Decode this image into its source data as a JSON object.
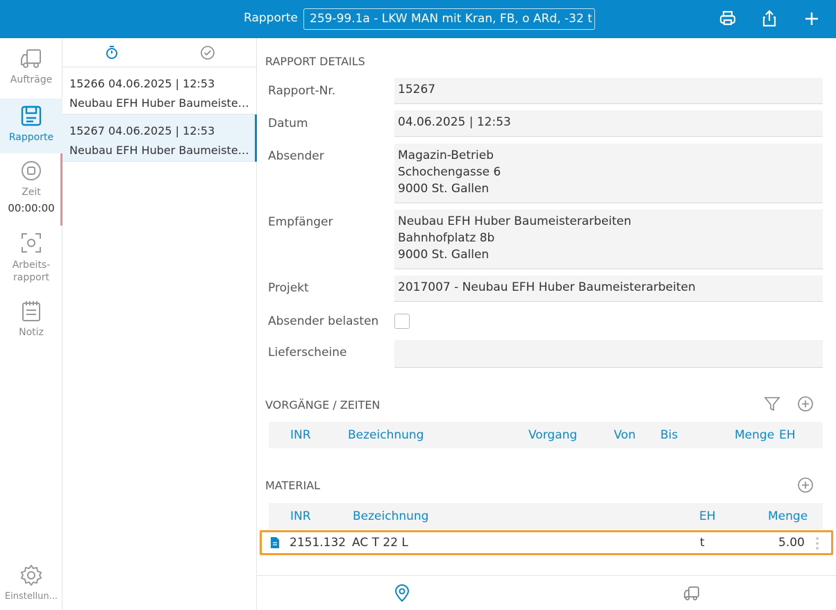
{
  "header": {
    "title": "Rapporte",
    "vehicle": "259-99.1a - LKW MAN mit Kran, FB, o ARd, -32 t",
    "icons": [
      "printer-icon",
      "share-icon",
      "plus-icon"
    ]
  },
  "nav": {
    "items": [
      {
        "label": "Aufträge",
        "icon": "truck-icon"
      },
      {
        "label": "Rapporte",
        "icon": "report-icon"
      },
      {
        "label": "Zeit",
        "icon": "stop-icon",
        "value": "00:00:00"
      },
      {
        "label": "Arbeits-\nrapport",
        "icon": "scan-icon"
      },
      {
        "label": "Notiz",
        "icon": "notepad-icon"
      },
      {
        "label": "Einstellun...",
        "icon": "gear-icon"
      }
    ]
  },
  "list": {
    "rows": [
      {
        "line1": "15266  04.06.2025 | 12:53",
        "line2": "Neubau EFH Huber Baumeisterarbeiten"
      },
      {
        "line1": "15267  04.06.2025 | 12:53",
        "line2": "Neubau EFH Huber Baumeisterarbeiten"
      }
    ]
  },
  "details": {
    "section": "RAPPORT DETAILS",
    "rapport_nr_label": "Rapport-Nr.",
    "rapport_nr": "15267",
    "datum_label": "Datum",
    "datum": "04.06.2025 | 12:53",
    "absender_label": "Absender",
    "absender": [
      "Magazin-Betrieb",
      "Schochengasse 6",
      "9000 St. Gallen"
    ],
    "empfaenger_label": "Empfänger",
    "empfaenger": [
      "Neubau EFH Huber Baumeisterarbeiten",
      "Bahnhofplatz 8b",
      "9000 St. Gallen"
    ],
    "projekt_label": "Projekt",
    "projekt": "2017007 - Neubau EFH Huber Baumeisterarbeiten",
    "absender_belasten_label": "Absender belasten",
    "absender_belasten": false,
    "lieferscheine_label": "Lieferscheine",
    "lieferscheine": ""
  },
  "vorgaenge": {
    "section": "VORGÄNGE / ZEITEN",
    "columns": [
      "INR",
      "Bezeichnung",
      "Vorgang",
      "Von",
      "Bis",
      "Menge",
      "EH"
    ]
  },
  "material": {
    "section": "MATERIAL",
    "columns": [
      "INR",
      "Bezeichnung",
      "EH",
      "Menge"
    ],
    "rows": [
      {
        "inr": "2151.132",
        "bezeichnung": "AC T 22 L",
        "eh": "t",
        "menge": "5.00"
      }
    ]
  },
  "colors": {
    "accent": "#0a88cc",
    "highlight": "#f0a030",
    "zeit_bar": "#f08a8a"
  }
}
